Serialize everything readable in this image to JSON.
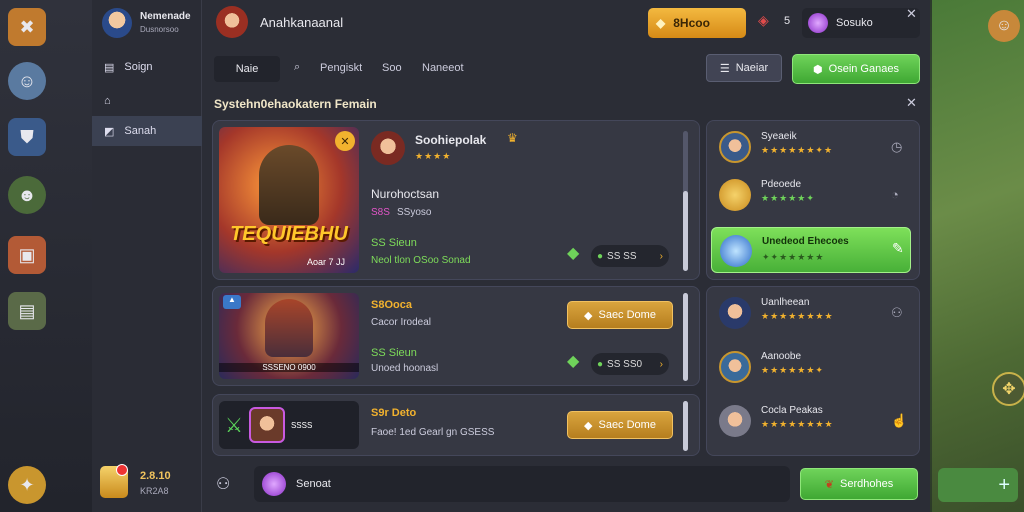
{
  "topbar": {
    "player_name": "Nemenade",
    "player_sub": "Dusnorsoo",
    "tab_title": "Anahkanaanal",
    "currency_gold": "8Hcoo",
    "gem_count": "5",
    "currency_purple": "Sosuko"
  },
  "sidenav": {
    "items": [
      {
        "label": "Soign"
      },
      {
        "label": ""
      },
      {
        "label": "Sanah"
      }
    ],
    "footer_value": "2.8.10",
    "footer_sub": "KR2A8"
  },
  "tabs": [
    "Naie",
    "Pengiskt",
    "Soo",
    "Naneeot"
  ],
  "toolbar": {
    "menu_label": "Naeiar",
    "action_label": "Osein Ganaes"
  },
  "section_title": "Systehn0ehaokatern Femain",
  "featured": {
    "banner_text": "TEQUIEBHU",
    "banner_code": "Aoar 7 JJ",
    "name": "Soohiepolak",
    "subtitle": "Nurohoctsan",
    "tag": "S8S",
    "tag_label": "SSyoso",
    "stat_label": "SS Sieun",
    "stat_sub": "Neol tlon OSoo Sonad",
    "price": "SS SS"
  },
  "items": [
    {
      "name": "S8Ooca",
      "desc": "Cacor Irodeal",
      "portrait_caption": "SSSENO 0900",
      "stat_label": "SS Sieun",
      "stat_sub": "Unoed hoonasl",
      "price": "SS SS0",
      "button": "Saec Dome"
    },
    {
      "name": "S9r Deto",
      "desc": "Faoe! 1ed Gearl gn GSESS",
      "portrait_caption": "SSSS",
      "button": "Saec Dome"
    }
  ],
  "right_top": [
    {
      "name": "Syeaeik",
      "rating": "★★★★★★✦★"
    },
    {
      "name": "Pdeoede",
      "rating": "★★★★★✦"
    },
    {
      "name": "Unedeod Ehecoes",
      "rating": "✦✦★★★★★"
    }
  ],
  "right_bottom": [
    {
      "name": "Uanlheean",
      "rating": "★★★★★★★★"
    },
    {
      "name": "Aanoobe",
      "rating": "★★★★★★✦"
    },
    {
      "name": "Cocla Peakas",
      "rating": "★★★★★★★★"
    }
  ],
  "bottombar": {
    "search_value": "Senoat",
    "submit_label": "Serdhohes"
  },
  "colors": {
    "gold": "#d9a43e",
    "green": "#55c046",
    "panel": "#2b2d36"
  }
}
